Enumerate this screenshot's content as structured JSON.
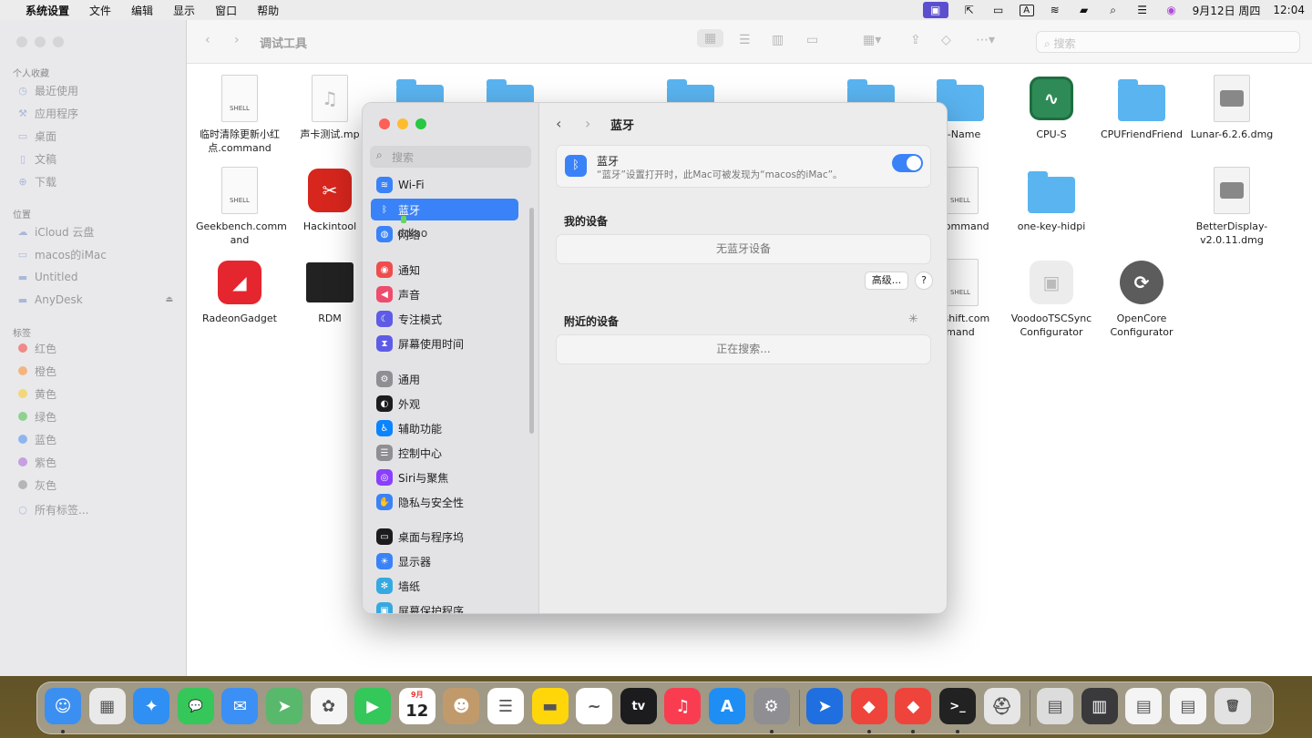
{
  "menubar": {
    "app_name": "系统设置",
    "menus": [
      "文件",
      "编辑",
      "显示",
      "窗口",
      "帮助"
    ],
    "date": "9月12日 周四",
    "time": "12:04",
    "input_indicator": "A"
  },
  "finder": {
    "title": "调试工具",
    "search_placeholder": "搜索",
    "sidebar": {
      "favorites_header": "个人收藏",
      "favorites": [
        "最近使用",
        "应用程序",
        "桌面",
        "文稿",
        "下载"
      ],
      "locations_header": "位置",
      "locations": [
        "iCloud 云盘",
        "macos的iMac",
        "Untitled",
        "AnyDesk"
      ],
      "tags_header": "标签",
      "tags": [
        {
          "name": "红色",
          "color": "#f08a87"
        },
        {
          "name": "橙色",
          "color": "#f3b57d"
        },
        {
          "name": "黄色",
          "color": "#f1d77a"
        },
        {
          "name": "绿色",
          "color": "#8fd18f"
        },
        {
          "name": "蓝色",
          "color": "#8fb5ef"
        },
        {
          "name": "紫色",
          "color": "#c59fe0"
        },
        {
          "name": "灰色",
          "color": "#b5b5b5"
        }
      ],
      "all_tags": "所有标签..."
    },
    "items": [
      {
        "name": "临时清除更新小红点.command",
        "line1": "临时清除更新小红",
        "line2": "点.command",
        "kind": "shell"
      },
      {
        "name": "声卡测试.mp",
        "line1": "声卡测试.mp",
        "line2": "",
        "kind": "audio"
      },
      {
        "name": "U-Name",
        "line1": "U-Name",
        "line2": "",
        "kind": "folder"
      },
      {
        "name": "CPU-S",
        "line1": "CPU-S",
        "line2": "",
        "kind": "app-green"
      },
      {
        "name": "CPUFriendFriend",
        "line1": "CPUFriendFriend",
        "line2": "",
        "kind": "folder"
      },
      {
        "name": "Lunar-6.2.6.dmg",
        "line1": "Lunar-6.2.6.dmg",
        "line2": "",
        "kind": "dmg"
      },
      {
        "name": "Geekbench.command",
        "line1": "Geekbench.comm",
        "line2": "and",
        "kind": "shell"
      },
      {
        "name": "Hackintool",
        "line1": "Hackintool",
        "line2": "",
        "kind": "app-red"
      },
      {
        "name": "P.command",
        "line1": "P.command",
        "line2": "",
        "kind": "shell"
      },
      {
        "name": "one-key-hidpi",
        "line1": "one-key-hidpi",
        "line2": "",
        "kind": "folder"
      },
      {
        "name": "BetterDisplay-v2.0.11.dmg",
        "line1": "BetterDisplay-",
        "line2": "v2.0.11.dmg",
        "kind": "dmg"
      },
      {
        "name": "RadeonGadget",
        "line1": "RadeonGadget",
        "line2": "",
        "kind": "app-amd"
      },
      {
        "name": "RDM",
        "line1": "RDM",
        "line2": "",
        "kind": "app-rdm"
      },
      {
        "name": "geshift.command",
        "line1": "geshift.com",
        "line2": "mand",
        "kind": "shell"
      },
      {
        "name": "VoodooTSCSync Configurator",
        "line1": "VoodooTSCSync",
        "line2": "Configurator",
        "kind": "app-white"
      },
      {
        "name": "OpenCore Configurator",
        "line1": "OpenCore",
        "line2": "Configurator",
        "kind": "app-gray"
      }
    ],
    "shell_label": "SHELL"
  },
  "settings": {
    "search_placeholder": "搜索",
    "nav_title": "蓝牙",
    "sidebar": [
      {
        "label": "Wi-Fi",
        "color": "#3a82f7",
        "icon": "wifi-icon",
        "glyph": "≋"
      },
      {
        "label": "蓝牙",
        "color": "#3a82f7",
        "icon": "bluetooth-icon",
        "glyph": "ᛒ",
        "selected": true
      },
      {
        "label": "网络",
        "color": "#3a82f7",
        "icon": "globe-icon",
        "glyph": "◍"
      },
      {
        "label": "通知",
        "color": "#ef4d4d",
        "icon": "bell-icon",
        "glyph": "◉"
      },
      {
        "label": "声音",
        "color": "#ee4c6c",
        "icon": "speaker-icon",
        "glyph": "◀"
      },
      {
        "label": "专注模式",
        "color": "#5e5ce6",
        "icon": "moon-icon",
        "glyph": "☾"
      },
      {
        "label": "屏幕使用时间",
        "color": "#5e5ce6",
        "icon": "hourglass-icon",
        "glyph": "⧗"
      },
      {
        "label": "通用",
        "color": "#8e8e93",
        "icon": "gear-icon",
        "glyph": "⚙"
      },
      {
        "label": "外观",
        "color": "#1c1c1e",
        "icon": "appearance-icon",
        "glyph": "◐"
      },
      {
        "label": "辅助功能",
        "color": "#0a84ff",
        "icon": "accessibility-icon",
        "glyph": "♿"
      },
      {
        "label": "控制中心",
        "color": "#8e8e93",
        "icon": "control-center-icon",
        "glyph": "☰"
      },
      {
        "label": "Siri与聚焦",
        "color": "#8a3ffc",
        "icon": "siri-icon",
        "glyph": "◎"
      },
      {
        "label": "隐私与安全性",
        "color": "#3a82f7",
        "icon": "hand-icon",
        "glyph": "✋"
      },
      {
        "label": "桌面与程序坞",
        "color": "#1c1c1e",
        "icon": "dock-icon",
        "glyph": "▭"
      },
      {
        "label": "显示器",
        "color": "#3a82f7",
        "icon": "display-icon",
        "glyph": "☀"
      },
      {
        "label": "墙纸",
        "color": "#36a9e0",
        "icon": "wallpaper-icon",
        "glyph": "✻"
      },
      {
        "label": "屏幕保护程序",
        "color": "#36a9e0",
        "icon": "screensaver-icon",
        "glyph": "▣"
      }
    ],
    "drag_overlay_text": "ddlao",
    "bluetooth": {
      "title": "蓝牙",
      "description": "“蓝牙”设置打开时，此Mac可被发现为“macos的iMac”。",
      "enabled": true
    },
    "my_devices": {
      "header": "我的设备",
      "empty": "无蓝牙设备"
    },
    "advanced_button": "高级...",
    "help_button": "?",
    "nearby": {
      "header": "附近的设备",
      "status": "正在搜索..."
    }
  },
  "dock": {
    "apps": [
      {
        "name": "Finder",
        "icon": "finder-icon",
        "color": "#3b8ff0",
        "glyph": "☺",
        "running": true
      },
      {
        "name": "Launchpad",
        "icon": "launchpad-icon",
        "color": "#e9e9e9",
        "glyph": "▦"
      },
      {
        "name": "Safari",
        "icon": "safari-icon",
        "color": "#2f8ff2",
        "glyph": "✦"
      },
      {
        "name": "Messages",
        "icon": "messages-icon",
        "color": "#35c759",
        "glyph": "💬"
      },
      {
        "name": "Mail",
        "icon": "mail-icon",
        "color": "#3c8ff5",
        "glyph": "✉"
      },
      {
        "name": "Maps",
        "icon": "maps-icon",
        "color": "#58b86b",
        "glyph": "➤"
      },
      {
        "name": "Photos",
        "icon": "photos-icon",
        "color": "#f5f5f5",
        "glyph": "✿"
      },
      {
        "name": "FaceTime",
        "icon": "facetime-icon",
        "color": "#34c759",
        "glyph": "▶"
      },
      {
        "name": "Calendar",
        "icon": "calendar-icon",
        "color": "#ffffff",
        "glyph": "12",
        "month": "9月"
      },
      {
        "name": "Contacts",
        "icon": "contacts-icon",
        "color": "#c19a6b",
        "glyph": "☻"
      },
      {
        "name": "Reminders",
        "icon": "reminders-icon",
        "color": "#ffffff",
        "glyph": "☰"
      },
      {
        "name": "Notes",
        "icon": "notes-icon",
        "color": "#ffd60a",
        "glyph": "▬"
      },
      {
        "name": "Freeform",
        "icon": "freeform-icon",
        "color": "#ffffff",
        "glyph": "~"
      },
      {
        "name": "Apple TV",
        "icon": "tv-icon",
        "color": "#1c1c1e",
        "glyph": "tv"
      },
      {
        "name": "Music",
        "icon": "music-icon",
        "color": "#fa3c50",
        "glyph": "♫"
      },
      {
        "name": "App Store",
        "icon": "appstore-icon",
        "color": "#1e8ef5",
        "glyph": "A"
      },
      {
        "name": "System Settings",
        "icon": "settings-icon",
        "color": "#8e8e93",
        "glyph": "⚙",
        "running": true
      },
      {
        "name": "Blue App",
        "icon": "blue-arrow-icon",
        "color": "#1f6fe0",
        "glyph": "➤"
      },
      {
        "name": "AnyDesk",
        "icon": "anydesk-icon",
        "color": "#ef443b",
        "glyph": "◆",
        "running": true
      },
      {
        "name": "AnyDesk Alt",
        "icon": "anydesk-alt-icon",
        "color": "#ef443b",
        "glyph": "◆",
        "running": true
      },
      {
        "name": "Terminal",
        "icon": "terminal-icon",
        "color": "#222222",
        "glyph": ">_",
        "running": true
      },
      {
        "name": "Disk Utility",
        "icon": "disk-utility-icon",
        "color": "#e6e6e6",
        "glyph": "⛑"
      },
      {
        "name": "Document",
        "icon": "document-icon",
        "color": "#dcdcdc",
        "glyph": "▤"
      },
      {
        "name": "Screenshot 1",
        "icon": "screenshot-icon",
        "color": "#3a3a3c",
        "glyph": "▥"
      },
      {
        "name": "Screenshot 2",
        "icon": "screenshot-icon-2",
        "color": "#f4f4f4",
        "glyph": "▤"
      },
      {
        "name": "Screenshot 3",
        "icon": "screenshot-icon-3",
        "color": "#f4f4f4",
        "glyph": "▤"
      },
      {
        "name": "Trash",
        "icon": "trash-icon",
        "color": "#e2e2e2",
        "glyph": "🗑"
      }
    ]
  }
}
